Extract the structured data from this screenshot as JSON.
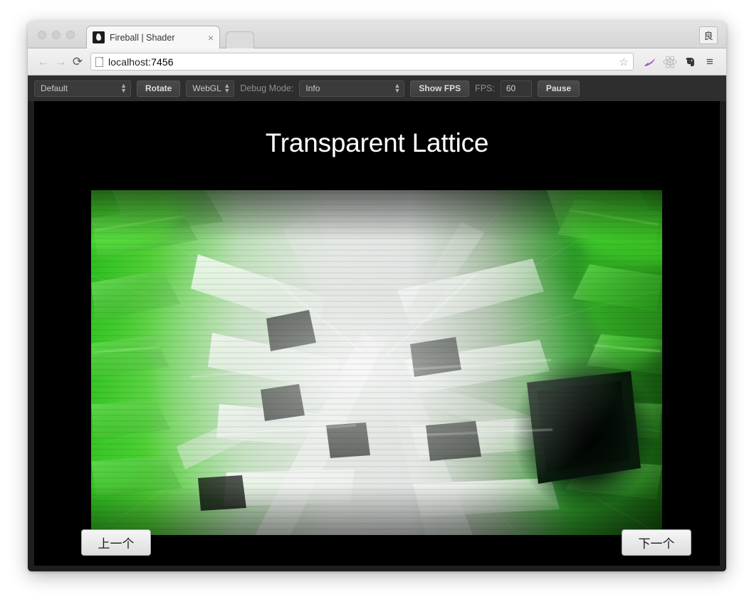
{
  "browser": {
    "tab": {
      "favicon": "fireball-flame-icon",
      "title": "Fireball | Shader",
      "close_label": "×"
    },
    "new_tab_label": "",
    "window_corner_icon": "良",
    "nav": {
      "back_label": "←",
      "forward_label": "→",
      "reload_label": "⟳"
    },
    "omnibox": {
      "url_scheme_icon": "page-document-icon",
      "url": "localhost:7456",
      "host": "localhost",
      "port": ":7456",
      "star_label": "☆"
    },
    "extensions": [
      {
        "name": "feather-icon",
        "glyph": "✒"
      },
      {
        "name": "react-atom-icon",
        "glyph": "⚛"
      },
      {
        "name": "evernote-elephant-icon",
        "glyph": "◆"
      }
    ],
    "menu_label": "≡"
  },
  "toolbar": {
    "preset_select": {
      "value": "Default",
      "options": [
        "Default"
      ]
    },
    "rotate_button": "Rotate",
    "renderer_select": {
      "value": "WebGL",
      "options": [
        "WebGL"
      ]
    },
    "debug_mode_label": "Debug Mode:",
    "debug_mode_select": {
      "value": "Info",
      "options": [
        "Info"
      ]
    },
    "show_fps_button": "Show FPS",
    "fps_label": "FPS:",
    "fps_value": "60",
    "pause_button": "Pause"
  },
  "stage": {
    "title": "Transparent Lattice",
    "prev_button": "上一个",
    "next_button": "下一个"
  },
  "colors": {
    "page_background": "#000000",
    "toolbar_background": "#2e2e2e",
    "title_color": "#ffffff",
    "shader_green_bright": "#3bd42a",
    "shader_green_deep": "#0d3c10",
    "shader_white": "#e8eae8",
    "shader_gray": "#9aa09c",
    "shader_dark": "#050805"
  }
}
